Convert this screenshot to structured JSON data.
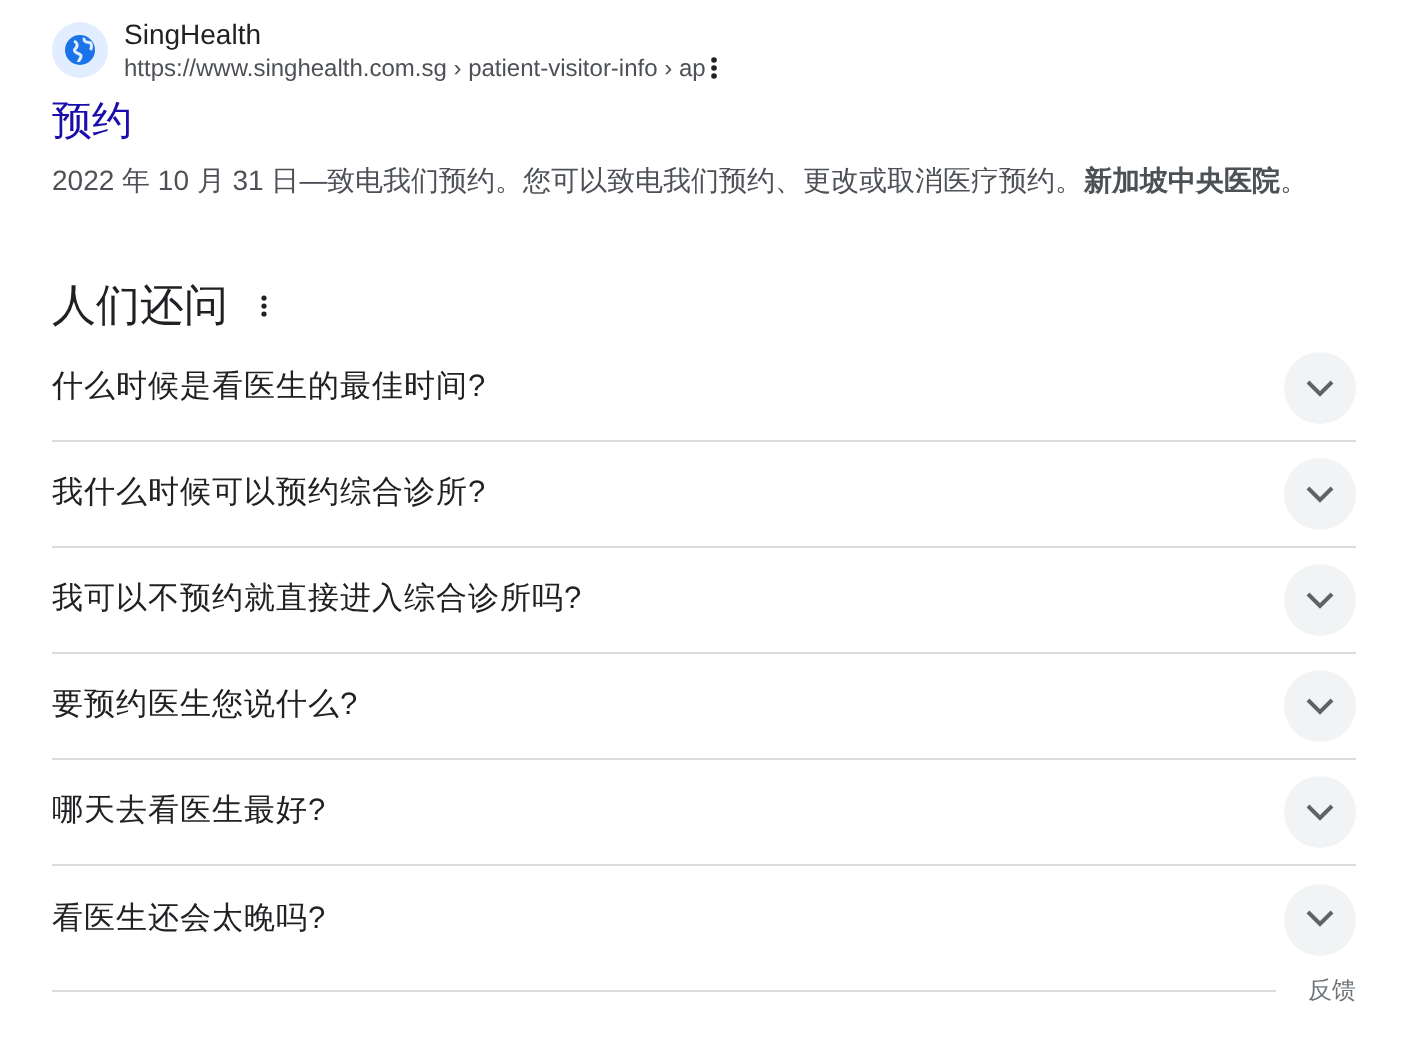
{
  "result": {
    "site_name": "SingHealth",
    "url": "https://www.singhealth.com.sg › patient-visitor-info › ap",
    "title": "预约",
    "snippet": "2022 年 10 月 31 日—致电我们预约。您可以致电我们预约、更改或取消医疗预约。**新加坡中央医院**。"
  },
  "people_also_ask": {
    "heading": "人们还问",
    "questions": [
      {
        "text": "什么时候是看医生的最佳时间?",
        "expanded": false
      },
      {
        "text": "我什么时候可以预约综合诊所?",
        "expanded": false
      },
      {
        "text": "我可以不预约就直接进入综合诊所吗?",
        "expanded": false
      },
      {
        "text": "要预约医生您说什么?",
        "expanded": false
      },
      {
        "text": "哪天去看医生最好?",
        "expanded": false
      },
      {
        "text": "看医生还会太晚吗?",
        "expanded": false
      }
    ],
    "feedback": "反馈"
  }
}
